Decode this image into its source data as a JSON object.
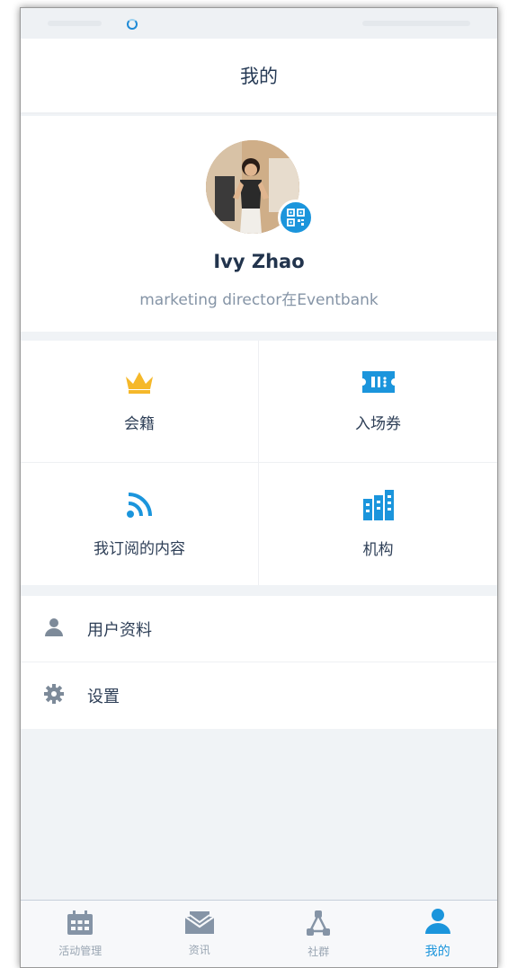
{
  "header": {
    "title": "我的"
  },
  "profile": {
    "name": "Ivy Zhao",
    "title": "marketing director在Eventbank"
  },
  "grid": [
    {
      "label": "会籍",
      "icon": "crown-icon",
      "color": "#f5b82a"
    },
    {
      "label": "入场券",
      "icon": "ticket-icon",
      "color": "#1b95dc"
    },
    {
      "label": "我订阅的内容",
      "icon": "rss-icon",
      "color": "#1b95dc"
    },
    {
      "label": "机构",
      "icon": "building-icon",
      "color": "#1b95dc"
    }
  ],
  "list": [
    {
      "label": "用户资料",
      "icon": "user-icon"
    },
    {
      "label": "设置",
      "icon": "gear-icon"
    }
  ],
  "tabbar": [
    {
      "label": "活动管理",
      "icon": "calendar-icon"
    },
    {
      "label": "资讯",
      "icon": "mail-icon"
    },
    {
      "label": "社群",
      "icon": "network-icon"
    },
    {
      "label": "我的",
      "icon": "user-icon",
      "active": true
    }
  ],
  "colors": {
    "accent": "#1b95dc",
    "gold": "#f5b82a",
    "muted": "#9aa6b3"
  }
}
